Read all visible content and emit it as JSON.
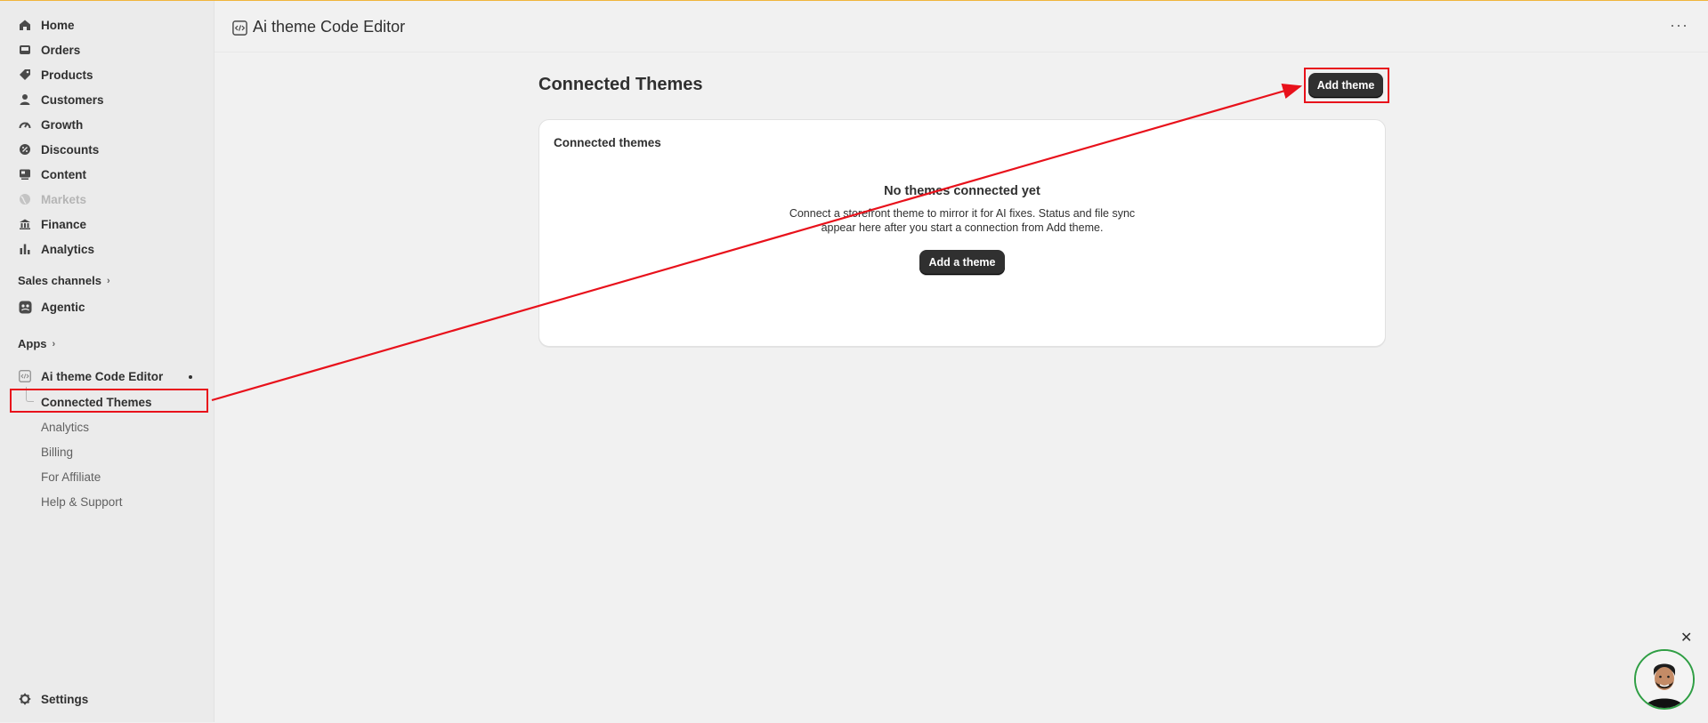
{
  "header": {
    "title": "Ai theme Code Editor",
    "more": "···"
  },
  "sidebar": {
    "items": [
      {
        "label": "Home",
        "icon": "home-icon"
      },
      {
        "label": "Orders",
        "icon": "inbox-icon"
      },
      {
        "label": "Products",
        "icon": "tag-icon"
      },
      {
        "label": "Customers",
        "icon": "person-icon"
      },
      {
        "label": "Growth",
        "icon": "gauge-icon"
      },
      {
        "label": "Discounts",
        "icon": "discount-icon"
      },
      {
        "label": "Content",
        "icon": "content-icon"
      },
      {
        "label": "Markets",
        "icon": "globe-icon"
      },
      {
        "label": "Finance",
        "icon": "bank-icon"
      },
      {
        "label": "Analytics",
        "icon": "bar-chart-icon"
      }
    ],
    "sales_channels": "Sales channels",
    "agentic": "Agentic",
    "apps": "Apps",
    "app_name": "Ai theme Code Editor",
    "sub_items": [
      "Connected Themes",
      "Analytics",
      "Billing",
      "For Affiliate",
      "Help & Support"
    ],
    "settings": "Settings"
  },
  "main": {
    "page_title": "Connected Themes",
    "add_theme_button": "Add theme",
    "card_title": "Connected themes",
    "empty_title": "No themes connected yet",
    "empty_description": "Connect a storefront theme to mirror it for AI fixes. Status and file sync appear here after you start a connection from Add theme.",
    "add_a_theme_button": "Add a theme"
  },
  "colors": {
    "annotation": "#e8111b",
    "primary_button": "#303030"
  }
}
